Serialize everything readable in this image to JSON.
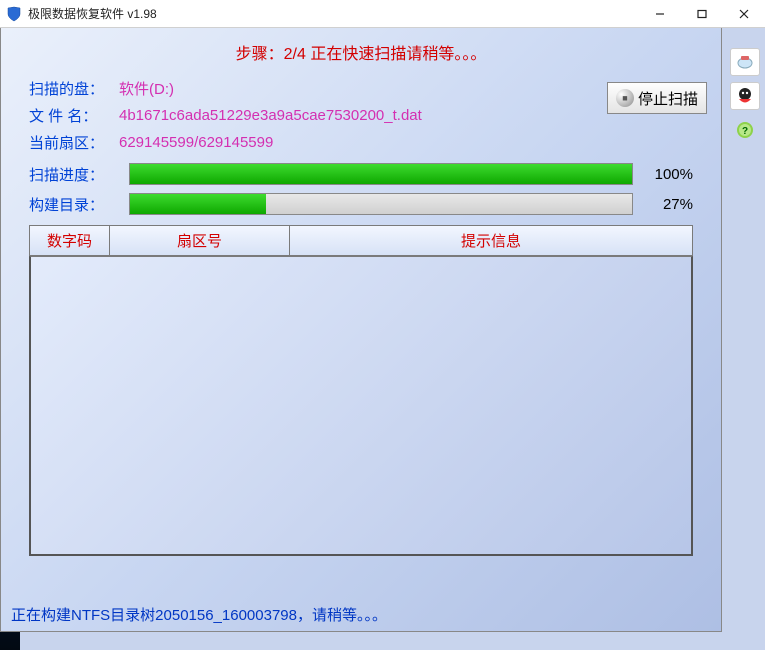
{
  "window": {
    "title": "极限数据恢复软件 v1.98"
  },
  "step": {
    "text": "步骤：2/4 正在快速扫描请稍等。。。"
  },
  "info": {
    "disk_label": "扫描的盘：",
    "disk_value": "软件(D:)",
    "file_label": "文 件 名：",
    "file_value": "4b1671c6ada51229e3a9a5cae7530200_t.dat",
    "sector_label": "当前扇区：",
    "sector_value": "629145599/629145599"
  },
  "stop_button": "停止扫描",
  "progress": {
    "scan": {
      "label": "扫描进度：",
      "percent": 100
    },
    "build": {
      "label": "构建目录：",
      "percent": 27
    }
  },
  "table": {
    "headers": [
      "数字码",
      "扇区号",
      "提示信息"
    ]
  },
  "status": "正在构建NTFS目录树2050156_160003798，请稍等。。。"
}
